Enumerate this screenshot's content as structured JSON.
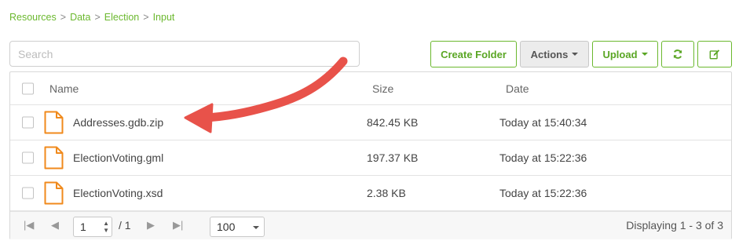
{
  "breadcrumb": {
    "items": [
      "Resources",
      "Data",
      "Election",
      "Input"
    ],
    "separator": ">"
  },
  "search": {
    "placeholder": "Search",
    "value": ""
  },
  "toolbar": {
    "create_folder": "Create Folder",
    "actions": "Actions",
    "upload": "Upload",
    "refresh_icon": "refresh-icon",
    "edit_icon": "edit-icon"
  },
  "table": {
    "columns": [
      "Name",
      "Size",
      "Date"
    ],
    "rows": [
      {
        "name": "Addresses.gdb.zip",
        "size": "842.45 KB",
        "date": "Today at 15:40:34",
        "icon": "file-icon"
      },
      {
        "name": "ElectionVoting.gml",
        "size": "197.37 KB",
        "date": "Today at 15:22:36",
        "icon": "file-icon"
      },
      {
        "name": "ElectionVoting.xsd",
        "size": "2.38 KB",
        "date": "Today at 15:22:36",
        "icon": "file-icon"
      }
    ]
  },
  "pager": {
    "first": "|◀",
    "prev": "◀",
    "current_page": "1",
    "of_pages": "/ 1",
    "next": "▶",
    "last": "▶|",
    "page_size": "100",
    "displaying": "Displaying 1 - 3 of 3"
  },
  "colors": {
    "accent_green": "#6bb82e",
    "file_icon_orange": "#f08a1c",
    "annotation_arrow": "#e8524a"
  }
}
